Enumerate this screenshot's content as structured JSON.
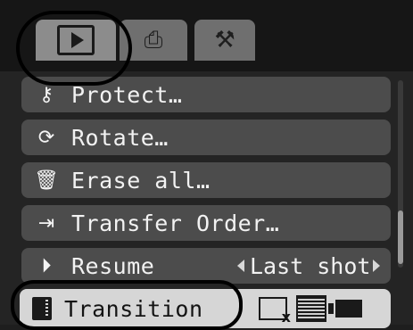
{
  "tabs": [
    {
      "name": "play-icon",
      "active": true
    },
    {
      "name": "print-icon",
      "active": false
    },
    {
      "name": "setup-icon",
      "active": false
    }
  ],
  "menu": {
    "items": [
      {
        "label": "Protect…",
        "icon": "key-icon"
      },
      {
        "label": "Rotate…",
        "icon": "rotate-icon"
      },
      {
        "label": "Erase all…",
        "icon": "erase-all-icon"
      },
      {
        "label": "Transfer Order…",
        "icon": "transfer-icon"
      },
      {
        "label": "Resume",
        "icon": "resume-icon",
        "value": "Last shot"
      },
      {
        "label": "Transition",
        "icon": "transition-icon",
        "selected": true,
        "options": [
          "off-icon",
          "dissolve-icon",
          "slide-icon"
        ]
      }
    ]
  },
  "colors": {
    "background": "#242424",
    "item_bg": "#4c4c4c",
    "selected_bg": "#d6d6d6",
    "text": "#f2f2f2"
  }
}
